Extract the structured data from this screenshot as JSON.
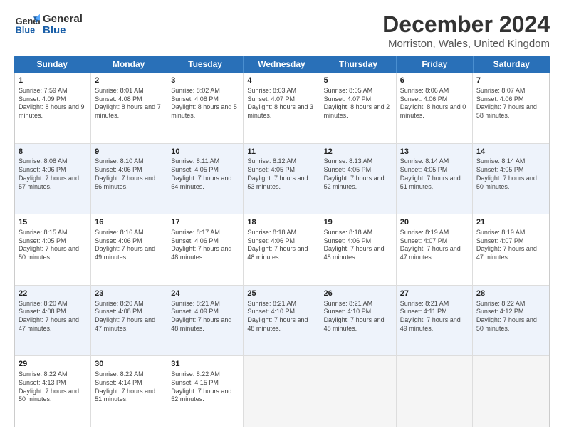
{
  "header": {
    "logo_line1": "General",
    "logo_line2": "Blue",
    "title": "December 2024",
    "subtitle": "Morriston, Wales, United Kingdom"
  },
  "calendar": {
    "days": [
      "Sunday",
      "Monday",
      "Tuesday",
      "Wednesday",
      "Thursday",
      "Friday",
      "Saturday"
    ],
    "rows": [
      [
        {
          "day": "1",
          "rise": "7:59 AM",
          "set": "4:09 PM",
          "daylight": "8 hours and 9 minutes."
        },
        {
          "day": "2",
          "rise": "8:01 AM",
          "set": "4:08 PM",
          "daylight": "8 hours and 7 minutes."
        },
        {
          "day": "3",
          "rise": "8:02 AM",
          "set": "4:08 PM",
          "daylight": "8 hours and 5 minutes."
        },
        {
          "day": "4",
          "rise": "8:03 AM",
          "set": "4:07 PM",
          "daylight": "8 hours and 3 minutes."
        },
        {
          "day": "5",
          "rise": "8:05 AM",
          "set": "4:07 PM",
          "daylight": "8 hours and 2 minutes."
        },
        {
          "day": "6",
          "rise": "8:06 AM",
          "set": "4:06 PM",
          "daylight": "8 hours and 0 minutes."
        },
        {
          "day": "7",
          "rise": "8:07 AM",
          "set": "4:06 PM",
          "daylight": "7 hours and 58 minutes."
        }
      ],
      [
        {
          "day": "8",
          "rise": "8:08 AM",
          "set": "4:06 PM",
          "daylight": "7 hours and 57 minutes."
        },
        {
          "day": "9",
          "rise": "8:10 AM",
          "set": "4:06 PM",
          "daylight": "7 hours and 56 minutes."
        },
        {
          "day": "10",
          "rise": "8:11 AM",
          "set": "4:05 PM",
          "daylight": "7 hours and 54 minutes."
        },
        {
          "day": "11",
          "rise": "8:12 AM",
          "set": "4:05 PM",
          "daylight": "7 hours and 53 minutes."
        },
        {
          "day": "12",
          "rise": "8:13 AM",
          "set": "4:05 PM",
          "daylight": "7 hours and 52 minutes."
        },
        {
          "day": "13",
          "rise": "8:14 AM",
          "set": "4:05 PM",
          "daylight": "7 hours and 51 minutes."
        },
        {
          "day": "14",
          "rise": "8:14 AM",
          "set": "4:05 PM",
          "daylight": "7 hours and 50 minutes."
        }
      ],
      [
        {
          "day": "15",
          "rise": "8:15 AM",
          "set": "4:05 PM",
          "daylight": "7 hours and 50 minutes."
        },
        {
          "day": "16",
          "rise": "8:16 AM",
          "set": "4:06 PM",
          "daylight": "7 hours and 49 minutes."
        },
        {
          "day": "17",
          "rise": "8:17 AM",
          "set": "4:06 PM",
          "daylight": "7 hours and 48 minutes."
        },
        {
          "day": "18",
          "rise": "8:18 AM",
          "set": "4:06 PM",
          "daylight": "7 hours and 48 minutes."
        },
        {
          "day": "19",
          "rise": "8:18 AM",
          "set": "4:06 PM",
          "daylight": "7 hours and 48 minutes."
        },
        {
          "day": "20",
          "rise": "8:19 AM",
          "set": "4:07 PM",
          "daylight": "7 hours and 47 minutes."
        },
        {
          "day": "21",
          "rise": "8:19 AM",
          "set": "4:07 PM",
          "daylight": "7 hours and 47 minutes."
        }
      ],
      [
        {
          "day": "22",
          "rise": "8:20 AM",
          "set": "4:08 PM",
          "daylight": "7 hours and 47 minutes."
        },
        {
          "day": "23",
          "rise": "8:20 AM",
          "set": "4:08 PM",
          "daylight": "7 hours and 47 minutes."
        },
        {
          "day": "24",
          "rise": "8:21 AM",
          "set": "4:09 PM",
          "daylight": "7 hours and 48 minutes."
        },
        {
          "day": "25",
          "rise": "8:21 AM",
          "set": "4:10 PM",
          "daylight": "7 hours and 48 minutes."
        },
        {
          "day": "26",
          "rise": "8:21 AM",
          "set": "4:10 PM",
          "daylight": "7 hours and 48 minutes."
        },
        {
          "day": "27",
          "rise": "8:21 AM",
          "set": "4:11 PM",
          "daylight": "7 hours and 49 minutes."
        },
        {
          "day": "28",
          "rise": "8:22 AM",
          "set": "4:12 PM",
          "daylight": "7 hours and 50 minutes."
        }
      ],
      [
        {
          "day": "29",
          "rise": "8:22 AM",
          "set": "4:13 PM",
          "daylight": "7 hours and 50 minutes."
        },
        {
          "day": "30",
          "rise": "8:22 AM",
          "set": "4:14 PM",
          "daylight": "7 hours and 51 minutes."
        },
        {
          "day": "31",
          "rise": "8:22 AM",
          "set": "4:15 PM",
          "daylight": "7 hours and 52 minutes."
        },
        null,
        null,
        null,
        null
      ]
    ]
  },
  "labels": {
    "sunrise": "Sunrise:",
    "sunset": "Sunset:",
    "daylight": "Daylight:"
  }
}
